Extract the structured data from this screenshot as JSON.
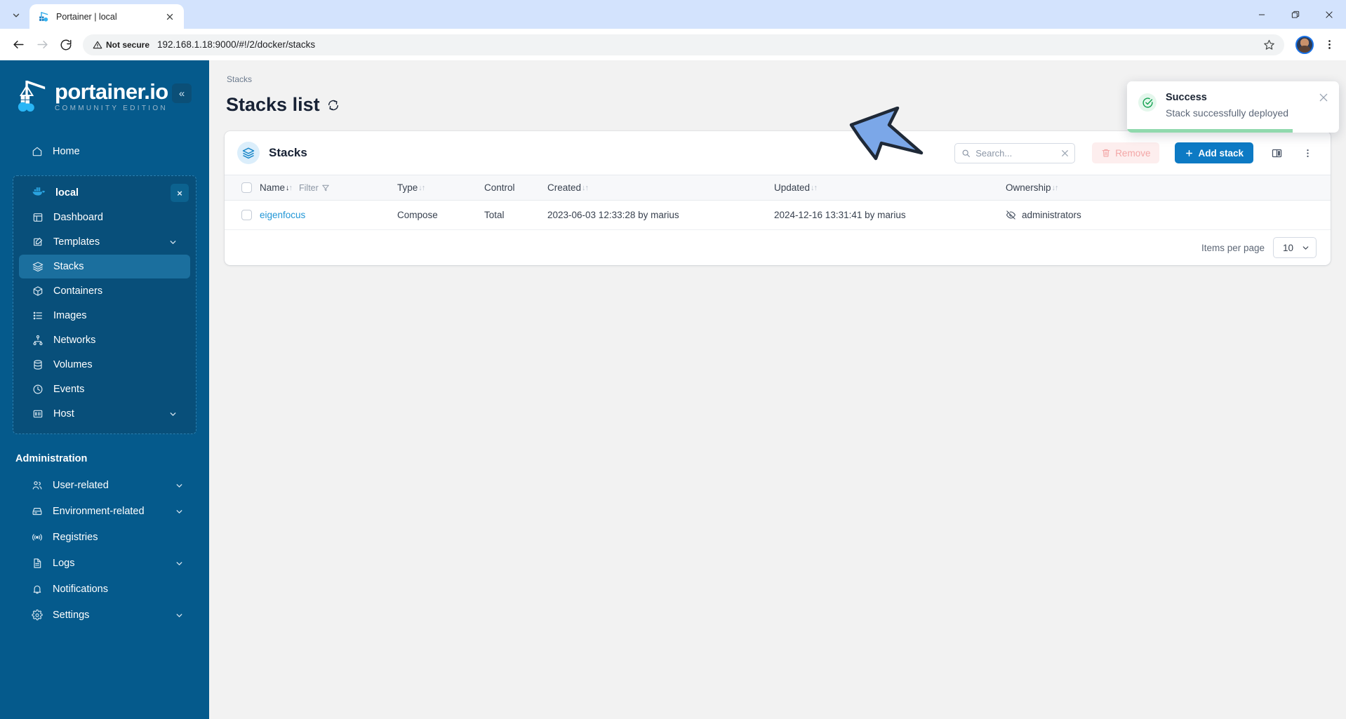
{
  "browser": {
    "tab": {
      "title": "Portainer | local",
      "favicon_icon": "portainer-favicon"
    },
    "tab_list_icon": "chevron-down-icon",
    "back_icon": "back-arrow-icon",
    "forward_icon": "forward-arrow-icon",
    "reload_icon": "reload-icon",
    "security": {
      "label": "Not secure",
      "icon": "warning-triangle-icon"
    },
    "url": "192.168.1.18:9000/#!/2/docker/stacks",
    "bookmark_icon": "star-icon",
    "profile_icon": "avatar",
    "menu_icon": "kebab-menu-icon",
    "window": {
      "minimize": "—",
      "maximize": "❐",
      "close": "✕"
    }
  },
  "sidebar": {
    "brand": {
      "name": "portainer.io",
      "subtitle": "COMMUNITY EDITION",
      "logo_icon": "portainer-logo"
    },
    "collapse_icon": "double-chevron-left-icon",
    "collapse_label": "«",
    "home": {
      "label": "Home",
      "icon": "home-icon"
    },
    "environment": {
      "name": "local",
      "icon": "docker-whale-icon",
      "close_icon": "close-icon",
      "close_label": "×",
      "items": [
        {
          "label": "Dashboard",
          "icon": "dashboard-icon",
          "expandable": false,
          "active": false
        },
        {
          "label": "Templates",
          "icon": "templates-icon",
          "expandable": true,
          "active": false
        },
        {
          "label": "Stacks",
          "icon": "stacks-icon",
          "expandable": false,
          "active": true
        },
        {
          "label": "Containers",
          "icon": "containers-icon",
          "expandable": false,
          "active": false
        },
        {
          "label": "Images",
          "icon": "images-icon",
          "expandable": false,
          "active": false
        },
        {
          "label": "Networks",
          "icon": "networks-icon",
          "expandable": false,
          "active": false
        },
        {
          "label": "Volumes",
          "icon": "volumes-icon",
          "expandable": false,
          "active": false
        },
        {
          "label": "Events",
          "icon": "events-clock-icon",
          "expandable": false,
          "active": false
        },
        {
          "label": "Host",
          "icon": "host-icon",
          "expandable": true,
          "active": false
        }
      ]
    },
    "administration": {
      "title": "Administration",
      "items": [
        {
          "label": "User-related",
          "icon": "users-icon",
          "expandable": true
        },
        {
          "label": "Environment-related",
          "icon": "environment-icon",
          "expandable": true
        },
        {
          "label": "Registries",
          "icon": "registries-icon",
          "expandable": false
        },
        {
          "label": "Logs",
          "icon": "logs-document-icon",
          "expandable": true
        },
        {
          "label": "Notifications",
          "icon": "bell-icon",
          "expandable": false
        },
        {
          "label": "Settings",
          "icon": "gear-icon",
          "expandable": true
        }
      ]
    }
  },
  "main": {
    "breadcrumb": "Stacks",
    "page_title": "Stacks list",
    "refresh_icon": "refresh-icon",
    "card": {
      "icon": "stacks-icon",
      "title": "Stacks",
      "search": {
        "placeholder": "Search...",
        "value": "",
        "icon": "search-icon",
        "clear_icon": "close-icon",
        "clear_label": "✕"
      },
      "remove_button": {
        "label": "Remove",
        "icon": "trash-icon",
        "disabled": true
      },
      "add_button": {
        "label": "Add stack",
        "icon": "plus-icon",
        "plus": "+"
      },
      "columns_icon": "columns-layout-icon",
      "more_icon": "kebab-menu-icon",
      "table": {
        "columns": [
          {
            "key": "checkbox",
            "label": "",
            "sortable": false
          },
          {
            "key": "name",
            "label": "Name",
            "sortable": true,
            "sort": "asc",
            "filter_label": "Filter",
            "filter_icon": "funnel-icon"
          },
          {
            "key": "type",
            "label": "Type",
            "sortable": true
          },
          {
            "key": "control",
            "label": "Control",
            "sortable": false
          },
          {
            "key": "created",
            "label": "Created",
            "sortable": true
          },
          {
            "key": "updated",
            "label": "Updated",
            "sortable": true
          },
          {
            "key": "ownership",
            "label": "Ownership",
            "sortable": true
          }
        ],
        "rows": [
          {
            "name": "eigenfocus",
            "type": "Compose",
            "control": "Total",
            "created": "2023-06-03 12:33:28 by marius",
            "updated": "2024-12-16 13:31:41 by marius",
            "ownership": "administrators",
            "ownership_icon": "eye-off-icon"
          }
        ]
      },
      "footer": {
        "items_per_page_label": "Items per page",
        "items_per_page_value": "10",
        "chevron_icon": "chevron-down-icon"
      }
    }
  },
  "toast": {
    "title": "Success",
    "message": "Stack successfully deployed",
    "status_icon": "check-circle-icon",
    "close_icon": "close-icon",
    "close_label": "✕",
    "progress_percent": 78,
    "accent_color": "#8fd9ad"
  },
  "annotation": {
    "arrow_icon": "pointer-arrow-icon",
    "fill_color": "#7BA7E8",
    "stroke_color": "#1F2937"
  },
  "colors": {
    "sidebar_bg": "#055a8c",
    "sidebar_active": "#1b6f9e",
    "page_bg": "#f2f2f2",
    "primary": "#0d7ac4",
    "link": "#2196d6",
    "success": "#12a150"
  }
}
